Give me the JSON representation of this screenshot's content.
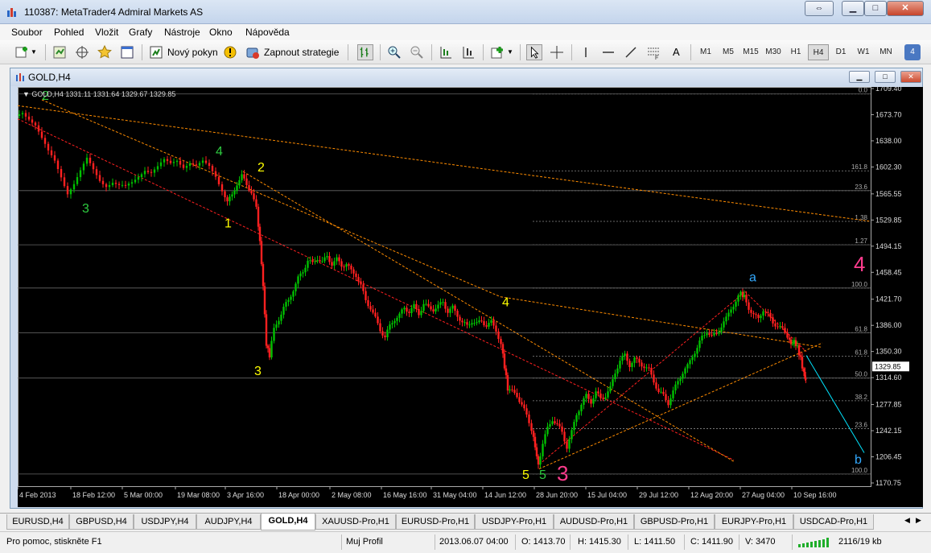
{
  "window": {
    "title": "110387: MetaTrader4 Admiral Markets AS"
  },
  "menu": [
    "Soubor",
    "Pohled",
    "Vložit",
    "Grafy",
    "Nástroje",
    "Okno",
    "Nápověda"
  ],
  "toolbar": {
    "new_order": "Nový pokyn",
    "strategy": "Zapnout strategie",
    "text_tool": "A",
    "timeframes": [
      "M1",
      "M5",
      "M15",
      "M30",
      "H1",
      "H4",
      "D1",
      "W1",
      "MN"
    ],
    "active_timeframe": "H4",
    "badge": "4"
  },
  "chart": {
    "window_title": "GOLD,H4",
    "info_line": "GOLD,H4  1331.11 1331.64 1329.67 1329.85",
    "current_price": "1329.85"
  },
  "chart_data": {
    "type": "candlestick",
    "symbol": "GOLD",
    "timeframe": "H4",
    "ylim": [
      1170.75,
      1709.4
    ],
    "y_ticks": [
      "1709.40",
      "1673.70",
      "1638.00",
      "1602.30",
      "1565.55",
      "1529.85",
      "1494.15",
      "1458.45",
      "1421.70",
      "1386.00",
      "1350.30",
      "1314.60",
      "1277.85",
      "1242.15",
      "1206.45",
      "1170.75"
    ],
    "x_labels": [
      "4 Feb 2013",
      "18 Feb 12:00",
      "5 Mar 00:00",
      "19 Mar 08:00",
      "3 Apr 16:00",
      "18 Apr 00:00",
      "2 May 08:00",
      "16 May 16:00",
      "31 May 04:00",
      "14 Jun 12:00",
      "28 Jun 20:00",
      "15 Jul 04:00",
      "29 Jul 12:00",
      "12 Aug 20:00",
      "27 Aug 04:00",
      "10 Sep 16:00"
    ],
    "close_path": [
      [
        0,
        1672
      ],
      [
        8,
        1678
      ],
      [
        16,
        1670
      ],
      [
        24,
        1660
      ],
      [
        32,
        1640
      ],
      [
        40,
        1622
      ],
      [
        48,
        1610
      ],
      [
        56,
        1590
      ],
      [
        64,
        1568
      ],
      [
        72,
        1580
      ],
      [
        80,
        1596
      ],
      [
        88,
        1612
      ],
      [
        96,
        1598
      ],
      [
        104,
        1585
      ],
      [
        112,
        1578
      ],
      [
        120,
        1582
      ],
      [
        128,
        1576
      ],
      [
        136,
        1574
      ],
      [
        144,
        1580
      ],
      [
        152,
        1590
      ],
      [
        160,
        1600
      ],
      [
        168,
        1596
      ],
      [
        176,
        1602
      ],
      [
        184,
        1610
      ],
      [
        192,
        1606
      ],
      [
        200,
        1612
      ],
      [
        208,
        1604
      ],
      [
        216,
        1609
      ],
      [
        224,
        1603
      ],
      [
        232,
        1608
      ],
      [
        240,
        1602
      ],
      [
        248,
        1590
      ],
      [
        256,
        1572
      ],
      [
        262,
        1555
      ],
      [
        268,
        1563
      ],
      [
        274,
        1580
      ],
      [
        280,
        1590
      ],
      [
        286,
        1578
      ],
      [
        292,
        1568
      ],
      [
        298,
        1545
      ],
      [
        302,
        1500
      ],
      [
        306,
        1440
      ],
      [
        310,
        1360
      ],
      [
        314,
        1345
      ],
      [
        320,
        1380
      ],
      [
        326,
        1395
      ],
      [
        332,
        1410
      ],
      [
        338,
        1420
      ],
      [
        344,
        1435
      ],
      [
        350,
        1450
      ],
      [
        356,
        1460
      ],
      [
        362,
        1475
      ],
      [
        368,
        1470
      ],
      [
        374,
        1478
      ],
      [
        380,
        1472
      ],
      [
        386,
        1480
      ],
      [
        392,
        1470
      ],
      [
        398,
        1476
      ],
      [
        404,
        1468
      ],
      [
        410,
        1470
      ],
      [
        416,
        1460
      ],
      [
        422,
        1455
      ],
      [
        428,
        1440
      ],
      [
        434,
        1420
      ],
      [
        440,
        1410
      ],
      [
        446,
        1395
      ],
      [
        452,
        1380
      ],
      [
        458,
        1370
      ],
      [
        464,
        1385
      ],
      [
        470,
        1395
      ],
      [
        476,
        1400
      ],
      [
        482,
        1410
      ],
      [
        488,
        1405
      ],
      [
        494,
        1412
      ],
      [
        500,
        1402
      ],
      [
        506,
        1415
      ],
      [
        512,
        1410
      ],
      [
        518,
        1408
      ],
      [
        524,
        1412
      ],
      [
        530,
        1418
      ],
      [
        536,
        1405
      ],
      [
        542,
        1410
      ],
      [
        548,
        1400
      ],
      [
        554,
        1390
      ],
      [
        560,
        1385
      ],
      [
        566,
        1392
      ],
      [
        572,
        1388
      ],
      [
        578,
        1392
      ],
      [
        584,
        1386
      ],
      [
        590,
        1390
      ],
      [
        596,
        1380
      ],
      [
        602,
        1360
      ],
      [
        606,
        1330
      ],
      [
        610,
        1300
      ],
      [
        616,
        1295
      ],
      [
        622,
        1290
      ],
      [
        628,
        1278
      ],
      [
        634,
        1262
      ],
      [
        640,
        1245
      ],
      [
        644,
        1220
      ],
      [
        648,
        1195
      ],
      [
        654,
        1225
      ],
      [
        660,
        1245
      ],
      [
        666,
        1258
      ],
      [
        672,
        1250
      ],
      [
        678,
        1240
      ],
      [
        684,
        1220
      ],
      [
        690,
        1240
      ],
      [
        696,
        1265
      ],
      [
        702,
        1278
      ],
      [
        708,
        1290
      ],
      [
        714,
        1282
      ],
      [
        720,
        1294
      ],
      [
        726,
        1286
      ],
      [
        732,
        1290
      ],
      [
        738,
        1300
      ],
      [
        744,
        1322
      ],
      [
        750,
        1338
      ],
      [
        756,
        1345
      ],
      [
        762,
        1332
      ],
      [
        768,
        1340
      ],
      [
        774,
        1335
      ],
      [
        780,
        1330
      ],
      [
        786,
        1325
      ],
      [
        792,
        1310
      ],
      [
        798,
        1295
      ],
      [
        804,
        1290
      ],
      [
        810,
        1280
      ],
      [
        816,
        1295
      ],
      [
        822,
        1310
      ],
      [
        828,
        1322
      ],
      [
        834,
        1330
      ],
      [
        840,
        1345
      ],
      [
        846,
        1355
      ],
      [
        852,
        1370
      ],
      [
        858,
        1378
      ],
      [
        864,
        1370
      ],
      [
        870,
        1375
      ],
      [
        876,
        1385
      ],
      [
        882,
        1395
      ],
      [
        888,
        1410
      ],
      [
        894,
        1418
      ],
      [
        900,
        1430
      ],
      [
        904,
        1425
      ],
      [
        910,
        1410
      ],
      [
        916,
        1400
      ],
      [
        922,
        1395
      ],
      [
        928,
        1408
      ],
      [
        934,
        1400
      ],
      [
        940,
        1390
      ],
      [
        946,
        1385
      ],
      [
        952,
        1380
      ],
      [
        958,
        1372
      ],
      [
        962,
        1360
      ],
      [
        966,
        1364
      ],
      [
        970,
        1356
      ],
      [
        974,
        1340
      ],
      [
        978,
        1320
      ],
      [
        980,
        1312
      ]
    ],
    "fib_levels": [
      {
        "label": "0.0",
        "price": 1702
      },
      {
        "label": "161.8",
        "price": 1597
      },
      {
        "label": "23.6",
        "price": 1570
      },
      {
        "label": "1.38",
        "price": 1528
      },
      {
        "label": "1.27",
        "price": 1496
      },
      {
        "label": "100.0",
        "price": 1437
      },
      {
        "label": "61.8",
        "price": 1376
      },
      {
        "label": "61.8",
        "price": 1344
      },
      {
        "label": "50.0",
        "price": 1314
      },
      {
        "label": "38.2",
        "price": 1283
      },
      {
        "label": "23.6",
        "price": 1245
      },
      {
        "label": "100.0",
        "price": 1183
      }
    ],
    "wave_labels": [
      {
        "text": "2",
        "color": "#2ecc40",
        "at": [
          30,
          1694
        ]
      },
      {
        "text": "3",
        "color": "#2ecc40",
        "at": [
          80,
          1540
        ]
      },
      {
        "text": "4",
        "color": "#2ecc40",
        "at": [
          246,
          1618
        ]
      },
      {
        "text": "1",
        "color": "#ffff00",
        "at": [
          257,
          1520
        ]
      },
      {
        "text": "2",
        "color": "#ffff00",
        "at": [
          298,
          1596
        ]
      },
      {
        "text": "3",
        "color": "#ffff00",
        "at": [
          294,
          1318
        ]
      },
      {
        "text": "4",
        "color": "#ffff00",
        "at": [
          602,
          1412
        ]
      },
      {
        "text": "5",
        "color": "#ffff00",
        "at": [
          627,
          1176
        ]
      },
      {
        "text": "5",
        "color": "#2ecc40",
        "at": [
          648,
          1176
        ]
      },
      {
        "text": "3",
        "color": "#ff3c8e",
        "at": [
          670,
          1174
        ]
      },
      {
        "text": "a",
        "color": "#33aaff",
        "at": [
          909,
          1446
        ]
      },
      {
        "text": "4",
        "color": "#ff3c8e",
        "at": [
          1039,
          1460
        ]
      },
      {
        "text": "b",
        "color": "#33aaff",
        "at": [
          1040,
          1197
        ]
      }
    ]
  },
  "tabs": [
    "EURUSD,H4",
    "GBPUSD,H4",
    "USDJPY,H4",
    "AUDJPY,H4",
    "GOLD,H4",
    "XAUUSD-Pro,H1",
    "EURUSD-Pro,H1",
    "USDJPY-Pro,H1",
    "AUDUSD-Pro,H1",
    "GBPUSD-Pro,H1",
    "EURJPY-Pro,H1",
    "USDCAD-Pro,H1"
  ],
  "active_tab": "GOLD,H4",
  "status": {
    "help": "Pro pomoc, stiskněte F1",
    "profile": "Muj Profil",
    "datetime": "2013.06.07 04:00",
    "open": "O: 1413.70",
    "high": "H: 1415.30",
    "low": "L: 1411.50",
    "close": "C: 1411.90",
    "volume": "V: 3470",
    "traffic": "2116/19 kb"
  },
  "colors": {
    "chart_bg": "#000000",
    "bull": "#00c000",
    "bear": "#ff2020",
    "grid": "#555555",
    "fib": "#ff8c00",
    "trend_red": "#ff2020",
    "projection": "#00e5ff"
  }
}
